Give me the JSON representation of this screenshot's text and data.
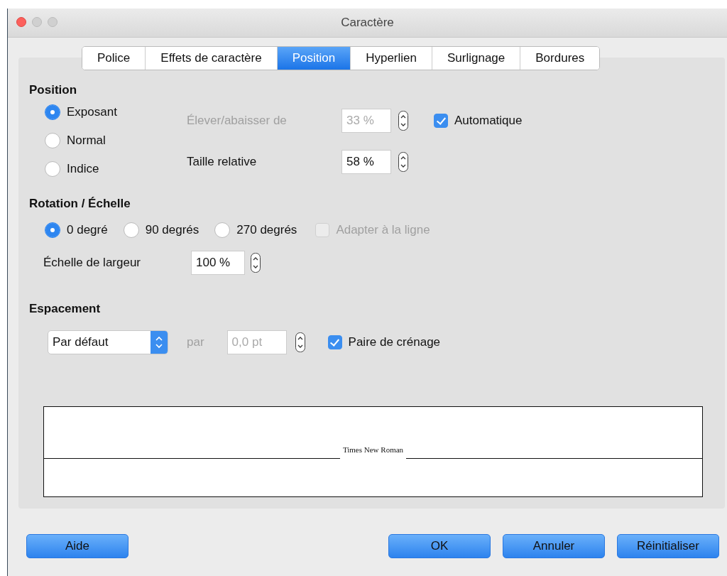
{
  "window": {
    "title": "Caractère"
  },
  "tabs": [
    {
      "label": "Police",
      "selected": false
    },
    {
      "label": "Effets de caractère",
      "selected": false
    },
    {
      "label": "Position",
      "selected": true
    },
    {
      "label": "Hyperlien",
      "selected": false
    },
    {
      "label": "Surlignage",
      "selected": false
    },
    {
      "label": "Bordures",
      "selected": false
    }
  ],
  "position": {
    "heading": "Position",
    "options": [
      {
        "label": "Exposant",
        "selected": true
      },
      {
        "label": "Normal",
        "selected": false
      },
      {
        "label": "Indice",
        "selected": false
      }
    ],
    "raise_label": {
      "text": "Élever/abaisser de",
      "disabled": true
    },
    "raise_value": {
      "value": "33 %",
      "disabled": true
    },
    "automatic": {
      "label": "Automatique",
      "checked": true,
      "disabled": false
    },
    "relative_size_label": "Taille relative",
    "relative_size_value": "58 %"
  },
  "rotation": {
    "heading": "Rotation / Échelle",
    "options": [
      {
        "label": "0 degré",
        "selected": true
      },
      {
        "label": "90 degrés",
        "selected": false
      },
      {
        "label": "270 degrés",
        "selected": false
      }
    ],
    "fit_to_line": {
      "label": "Adapter à la ligne",
      "checked": false,
      "disabled": true
    },
    "width_scale_label": "Échelle de largeur",
    "width_scale_value": "100 %"
  },
  "spacing": {
    "heading": "Espacement",
    "mode": "Par défaut",
    "by_label": {
      "text": "par",
      "disabled": true
    },
    "by_value": {
      "value": "0,0 pt",
      "disabled": true
    },
    "pair_kerning": {
      "label": "Paire de crénage",
      "checked": true,
      "disabled": false
    }
  },
  "preview": {
    "text": "Times New Roman"
  },
  "buttons": [
    "Aide",
    "OK",
    "Annuler",
    "Réinitialiser"
  ]
}
